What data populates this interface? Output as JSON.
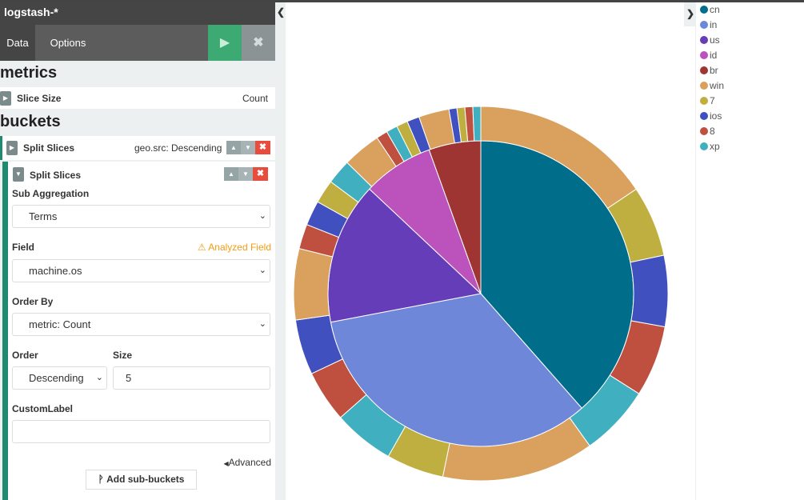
{
  "index_pattern": "logstash-*",
  "tabs": [
    {
      "label": "Data"
    },
    {
      "label": "Options"
    }
  ],
  "toolbar": {
    "apply_icon": "play-icon",
    "discard_icon": "close-icon"
  },
  "metrics": {
    "title": "metrics",
    "items": [
      {
        "label": "Slice Size",
        "value": "Count"
      }
    ]
  },
  "buckets": {
    "title": "buckets",
    "items": [
      {
        "label": "Split Slices",
        "description": "geo.src: Descending"
      },
      {
        "label": "Split Slices",
        "sub_aggregation": {
          "label": "Sub Aggregation",
          "value": "Terms"
        },
        "field": {
          "label": "Field",
          "value": "machine.os",
          "warning": "Analyzed Field"
        },
        "order_by": {
          "label": "Order By",
          "value": "metric: Count"
        },
        "order": {
          "label": "Order",
          "value": "Descending"
        },
        "size": {
          "label": "Size",
          "value": "5"
        },
        "custom_label": {
          "label": "CustomLabel",
          "value": ""
        },
        "advanced_label": "Advanced"
      }
    ],
    "add_sub_buckets_label": "Add sub-buckets"
  },
  "legend": [
    {
      "label": "cn",
      "color": "#006e8a"
    },
    {
      "label": "in",
      "color": "#6f87d8"
    },
    {
      "label": "us",
      "color": "#663db8"
    },
    {
      "label": "id",
      "color": "#bc52bc"
    },
    {
      "label": "br",
      "color": "#9e3533"
    },
    {
      "label": "win",
      "color": "#daa05d"
    },
    {
      "label": "7",
      "color": "#bfaf40"
    },
    {
      "label": "ios",
      "color": "#4050bf"
    },
    {
      "label": "8",
      "color": "#bf5040"
    },
    {
      "label": "xp",
      "color": "#40afbf"
    }
  ],
  "chart_data": {
    "type": "pie",
    "donut": false,
    "inner_ring": [
      {
        "label": "cn",
        "value": 38.5,
        "color": "#006e8a"
      },
      {
        "label": "in",
        "value": 33.5,
        "color": "#6f87d8"
      },
      {
        "label": "us",
        "value": 15.0,
        "color": "#663db8"
      },
      {
        "label": "id",
        "value": 7.5,
        "color": "#bc52bc"
      },
      {
        "label": "br",
        "value": 5.5,
        "color": "#9e3533"
      }
    ],
    "outer_ring": [
      {
        "parent": "cn",
        "label": "win",
        "value": 16.0,
        "color": "#daa05d"
      },
      {
        "parent": "cn",
        "label": "7",
        "value": 6.3,
        "color": "#bfaf40"
      },
      {
        "parent": "cn",
        "label": "ios",
        "value": 6.3,
        "color": "#4050bf"
      },
      {
        "parent": "cn",
        "label": "8",
        "value": 6.3,
        "color": "#bf5040"
      },
      {
        "parent": "cn",
        "label": "xp",
        "value": 6.3,
        "color": "#40afbf"
      },
      {
        "parent": "in",
        "label": "win",
        "value": 13.5,
        "color": "#daa05d"
      },
      {
        "parent": "in",
        "label": "7",
        "value": 5.1,
        "color": "#bfaf40"
      },
      {
        "parent": "in",
        "label": "xp",
        "value": 5.4,
        "color": "#40afbf"
      },
      {
        "parent": "in",
        "label": "8",
        "value": 4.6,
        "color": "#bf5040"
      },
      {
        "parent": "in",
        "label": "ios",
        "value": 4.9,
        "color": "#4050bf"
      },
      {
        "parent": "us",
        "label": "win",
        "value": 6.3,
        "color": "#daa05d"
      },
      {
        "parent": "us",
        "label": "8",
        "value": 2.2,
        "color": "#bf5040"
      },
      {
        "parent": "us",
        "label": "ios",
        "value": 2.2,
        "color": "#4050bf"
      },
      {
        "parent": "us",
        "label": "7",
        "value": 2.1,
        "color": "#bfaf40"
      },
      {
        "parent": "us",
        "label": "xp",
        "value": 2.2,
        "color": "#40afbf"
      },
      {
        "parent": "id",
        "label": "win",
        "value": 3.4,
        "color": "#daa05d"
      },
      {
        "parent": "id",
        "label": "8",
        "value": 1.0,
        "color": "#bf5040"
      },
      {
        "parent": "id",
        "label": "xp",
        "value": 1.0,
        "color": "#40afbf"
      },
      {
        "parent": "id",
        "label": "7",
        "value": 1.0,
        "color": "#bfaf40"
      },
      {
        "parent": "id",
        "label": "ios",
        "value": 1.1,
        "color": "#4050bf"
      },
      {
        "parent": "br",
        "label": "win",
        "value": 2.7,
        "color": "#daa05d"
      },
      {
        "parent": "br",
        "label": "ios",
        "value": 0.7,
        "color": "#4050bf"
      },
      {
        "parent": "br",
        "label": "7",
        "value": 0.7,
        "color": "#bfaf40"
      },
      {
        "parent": "br",
        "label": "8",
        "value": 0.7,
        "color": "#bf5040"
      },
      {
        "parent": "br",
        "label": "xp",
        "value": 0.7,
        "color": "#40afbf"
      }
    ]
  }
}
